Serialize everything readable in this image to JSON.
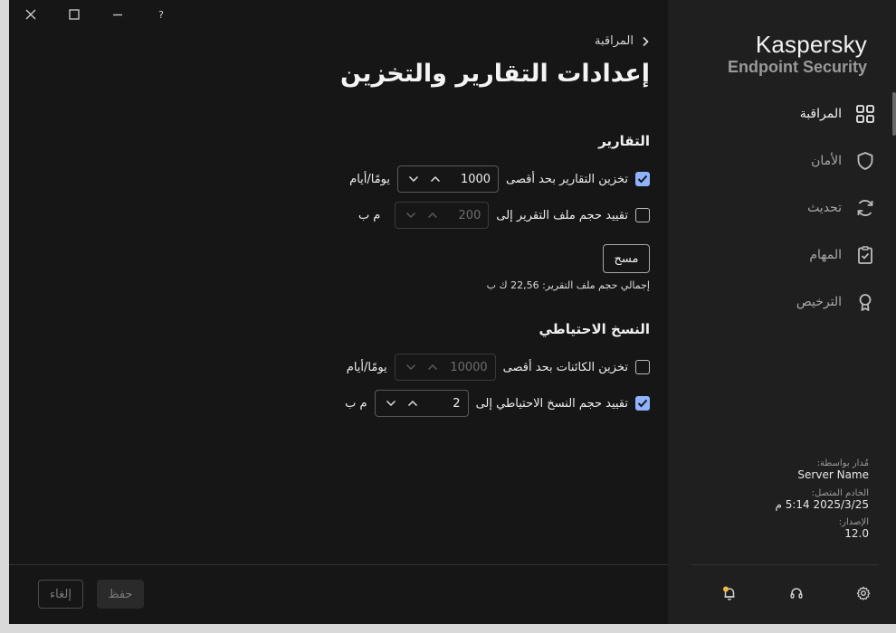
{
  "window": {
    "help_label": "?"
  },
  "brand": {
    "name": "Kaspersky",
    "product": "Endpoint Security"
  },
  "nav": {
    "items": [
      {
        "label": "المراقبة",
        "icon": "grid-icon",
        "active": true
      },
      {
        "label": "الأمان",
        "icon": "shield-icon",
        "active": false
      },
      {
        "label": "تحديث",
        "icon": "refresh-icon",
        "active": false
      },
      {
        "label": "المهام",
        "icon": "clipboard-check-icon",
        "active": false
      },
      {
        "label": "الترخيص",
        "icon": "award-icon",
        "active": false
      }
    ]
  },
  "info": {
    "managed_by_label": "مُدار بواسطة:",
    "managed_by_value": "Server Name",
    "connected_label": "الخادم المتصل:",
    "connected_value": "2025/3/25 5:14 م",
    "version_label": "الإصدار:",
    "version_value": "12.0"
  },
  "main": {
    "breadcrumb": "المراقبة",
    "title": "إعدادات التقارير والتخزين",
    "reports": {
      "title": "التقارير",
      "store_label": "تخزين التقارير بحد أقصى",
      "store_checked": true,
      "store_value": "1000",
      "store_unit": "يومًا/أيام",
      "limit_label": "تقييد حجم ملف التقرير إلى",
      "limit_checked": false,
      "limit_value": "200",
      "limit_unit": "م ب",
      "clear_button": "مسح",
      "total_size": "إجمالي حجم ملف التقرير: 22,56 ك ب"
    },
    "backup": {
      "title": "النسخ الاحتياطي",
      "store_label": "تخزين الكائنات بحد أقصى",
      "store_checked": false,
      "store_value": "10000",
      "store_unit": "يومًا/أيام",
      "limit_label": "تقييد حجم النسخ الاحتياطي إلى",
      "limit_checked": true,
      "limit_value": "2",
      "limit_unit": "م ب"
    }
  },
  "footer": {
    "save_label": "حفظ",
    "cancel_label": "إلغاء"
  },
  "colors": {
    "accent": "#8fb3ff",
    "notification_dot": "#f5b93a"
  }
}
